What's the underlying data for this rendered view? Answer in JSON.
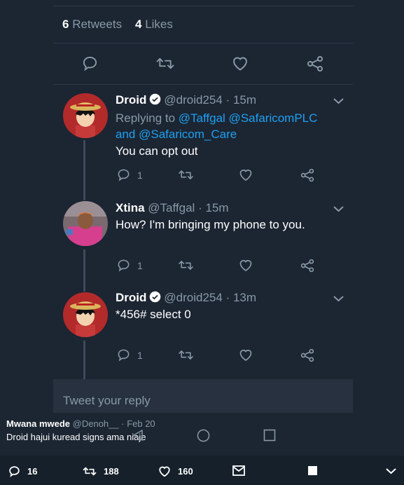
{
  "stats": {
    "retweets_count": "6",
    "retweets_label": "Retweets",
    "likes_count": "4",
    "likes_label": "Likes"
  },
  "replies": [
    {
      "name": "Droid",
      "handle": "@droid254",
      "time": "· 15m",
      "replying_prefix": "Replying to",
      "replying_mentions_1": "@Taffgal @SafaricomPLC",
      "replying_and": "and",
      "replying_mentions_2": "@Safaricom_Care",
      "text": "You can opt out",
      "reply_count": "1"
    },
    {
      "name": "Xtina",
      "handle": "@Taffgal",
      "time": "· 15m",
      "text": "How? I'm bringing my phone to you.",
      "reply_count": "1"
    },
    {
      "name": "Droid",
      "handle": "@droid254",
      "time": "· 13m",
      "text": "*456# select 0",
      "reply_count": "1"
    }
  ],
  "reply_box": {
    "placeholder": "Tweet your reply"
  },
  "quoted": {
    "name": "Mwana mwede",
    "handle": "@Denoh__",
    "date": "· Feb 20",
    "text": "Droid hajui kuread signs ama niaje"
  },
  "bottom_bar": {
    "replies": "16",
    "retweets": "188",
    "likes": "160"
  },
  "colors": {
    "background": "#1c2532",
    "accent": "#1da1f2",
    "muted": "#8899a6"
  }
}
